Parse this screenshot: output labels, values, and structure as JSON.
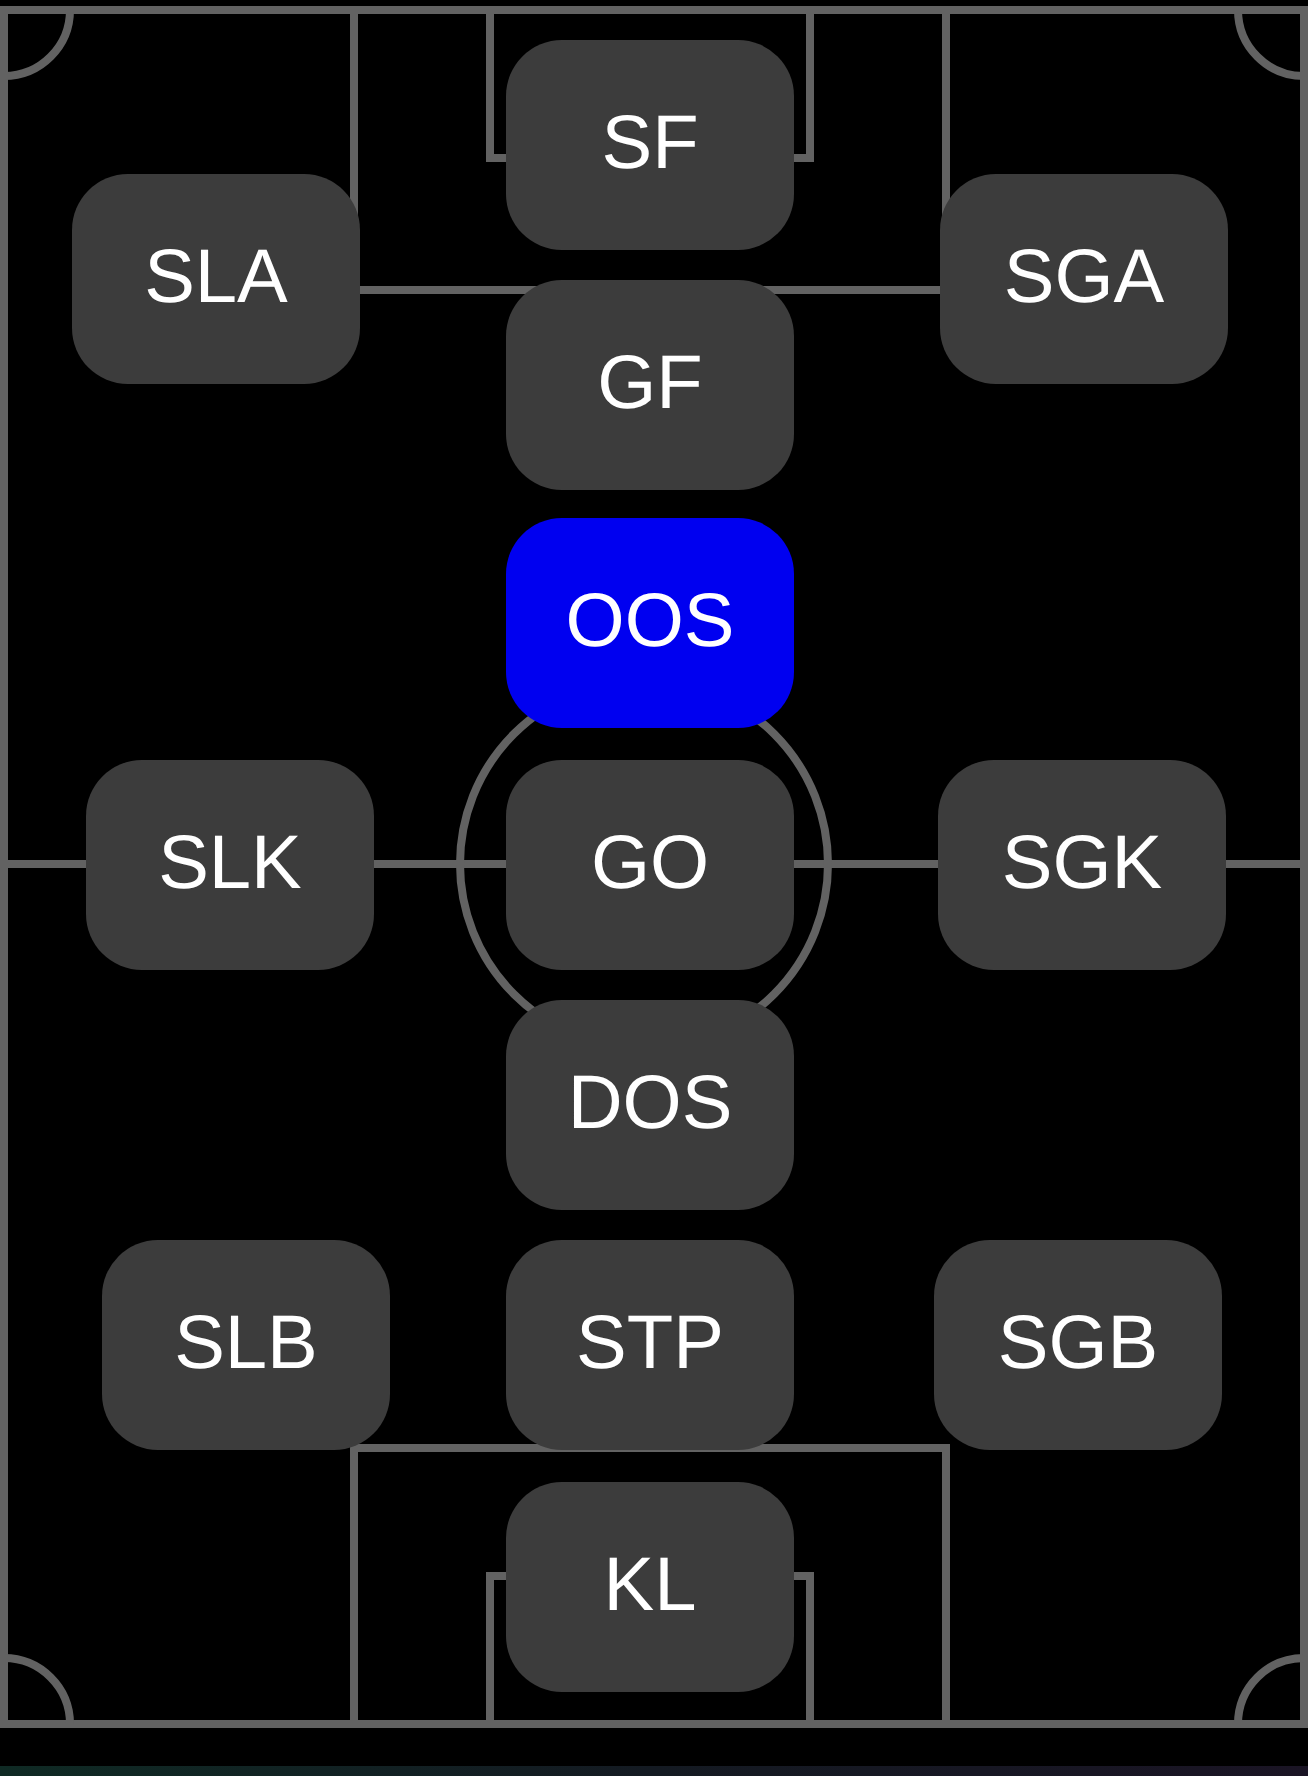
{
  "pitch": {
    "left": [
      {
        "label": "SLA",
        "selected": false
      },
      {
        "label": "SLK",
        "selected": false
      },
      {
        "label": "SLB",
        "selected": false
      }
    ],
    "center": [
      {
        "label": "SF",
        "selected": false
      },
      {
        "label": "GF",
        "selected": false
      },
      {
        "label": "OOS",
        "selected": true
      },
      {
        "label": "GO",
        "selected": false
      },
      {
        "label": "DOS",
        "selected": false
      },
      {
        "label": "STP",
        "selected": false
      },
      {
        "label": "KL",
        "selected": false
      }
    ],
    "right": [
      {
        "label": "SGA",
        "selected": false
      },
      {
        "label": "SGK",
        "selected": false
      },
      {
        "label": "SGB",
        "selected": false
      }
    ]
  }
}
